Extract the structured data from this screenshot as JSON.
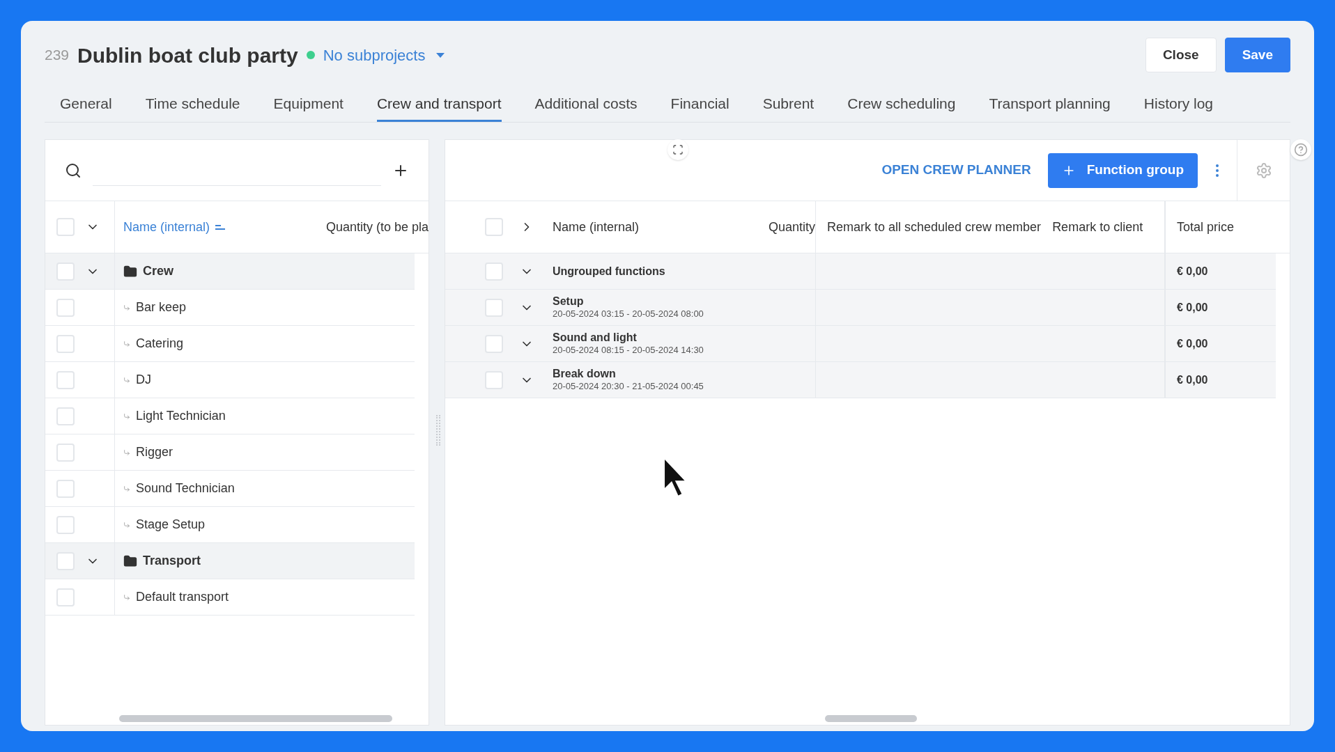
{
  "header": {
    "number": "239",
    "title": "Dublin boat club party",
    "subprojects": "No subprojects",
    "buttons": [
      {
        "label": "Close",
        "kind": "secondary"
      },
      {
        "label": "Save",
        "kind": "primary"
      }
    ]
  },
  "tabs": [
    {
      "label": "General",
      "selected": false
    },
    {
      "label": "Time schedule",
      "selected": false
    },
    {
      "label": "Equipment",
      "selected": false
    },
    {
      "label": "Crew and transport",
      "selected": true
    },
    {
      "label": "Additional costs",
      "selected": false
    },
    {
      "label": "Financial",
      "selected": false
    },
    {
      "label": "Subrent",
      "selected": false
    },
    {
      "label": "Crew scheduling",
      "selected": false
    },
    {
      "label": "Transport planning",
      "selected": false
    },
    {
      "label": "History log",
      "selected": false
    }
  ],
  "left_table": {
    "all_checked": false,
    "columns": [
      "Name (internal)",
      "Quantity (to be pla"
    ],
    "rows": [
      {
        "name": "Crew",
        "checked": false,
        "expanded": true,
        "children": [
          {
            "name": "Bar keep",
            "checked": false
          },
          {
            "name": "Catering",
            "checked": false
          },
          {
            "name": "DJ",
            "checked": false
          },
          {
            "name": "Light Technician",
            "checked": false
          },
          {
            "name": "Rigger",
            "checked": false
          },
          {
            "name": "Sound Technician",
            "checked": false
          },
          {
            "name": "Stage Setup",
            "checked": false
          }
        ]
      },
      {
        "name": "Transport",
        "checked": false,
        "expanded": true,
        "children": [
          {
            "name": "Default transport",
            "checked": false
          }
        ]
      }
    ]
  },
  "right_panel": {
    "planner_link": "OPEN CREW PLANNER",
    "add_button": "Function group",
    "all_checked": false,
    "columns": [
      "Name (internal)",
      "Quantity",
      "Remark to all scheduled crew member",
      "Remark to client",
      "Total price"
    ],
    "rows": [
      {
        "name": "Ungrouped functions",
        "checked": false,
        "total": "€ 0,00"
      },
      {
        "name": "Setup",
        "checked": false,
        "period": "20-05-2024 03:15 - 20-05-2024 08:00",
        "total": "€ 0,00"
      },
      {
        "name": "Sound and light",
        "checked": false,
        "period": "20-05-2024 08:15 - 20-05-2024 14:30",
        "total": "€ 0,00"
      },
      {
        "name": "Break down",
        "checked": false,
        "period": "20-05-2024 20:30 - 21-05-2024 00:45",
        "total": "€ 0,00"
      }
    ]
  }
}
